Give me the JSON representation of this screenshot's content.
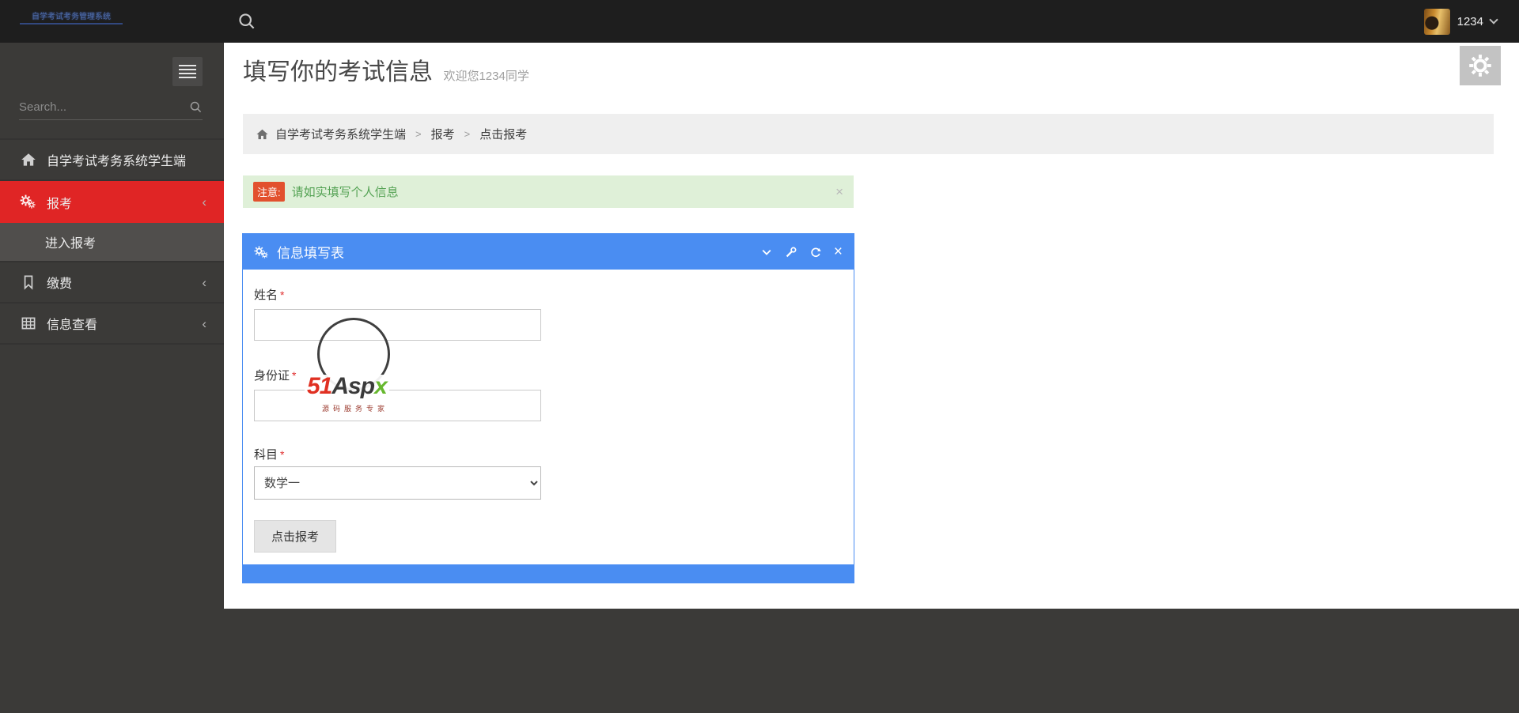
{
  "navbar": {
    "logo_text": "自学考试考务管理系统",
    "username": "1234"
  },
  "sidebar": {
    "search_placeholder": "Search...",
    "items": {
      "home": "自学考试考务系统学生端",
      "baokao": "报考",
      "enter_baokao": "进入报考",
      "jiaofei": "缴费",
      "info_view": "信息查看"
    }
  },
  "page": {
    "title": "填写你的考试信息",
    "subtitle": "欢迎您1234同学"
  },
  "breadcrumb": {
    "home": "自学考试考务系统学生端",
    "separator": ">",
    "level1": "报考",
    "current": "点击报考"
  },
  "alert": {
    "badge": "注意:",
    "message": "请如实填写个人信息",
    "close": "×"
  },
  "panel": {
    "title": "信息填写表",
    "close": "×",
    "fields": [
      {
        "label": "姓名",
        "required_mark": "*",
        "value": ""
      },
      {
        "label": "身份证",
        "required_mark": "*",
        "value": ""
      },
      {
        "label": "科目",
        "required_mark": "*",
        "value": "数学一"
      }
    ],
    "submit_label": "点击报考"
  },
  "watermark": {
    "part1": "51",
    "part2": "Asp",
    "part3": "x",
    "tagline": "源码服务专家"
  },
  "icons": {
    "chevron_left": "‹"
  },
  "colors": {
    "sidebar_active_red": "#e02525",
    "panel_blue": "#4a8df2",
    "alert_bg_green": "#dff0d8",
    "alert_text_green": "#54a254",
    "badge_red": "#e2512e",
    "navbar_bg": "#1e1e1e",
    "sidebar_bg": "#3b3a38"
  }
}
